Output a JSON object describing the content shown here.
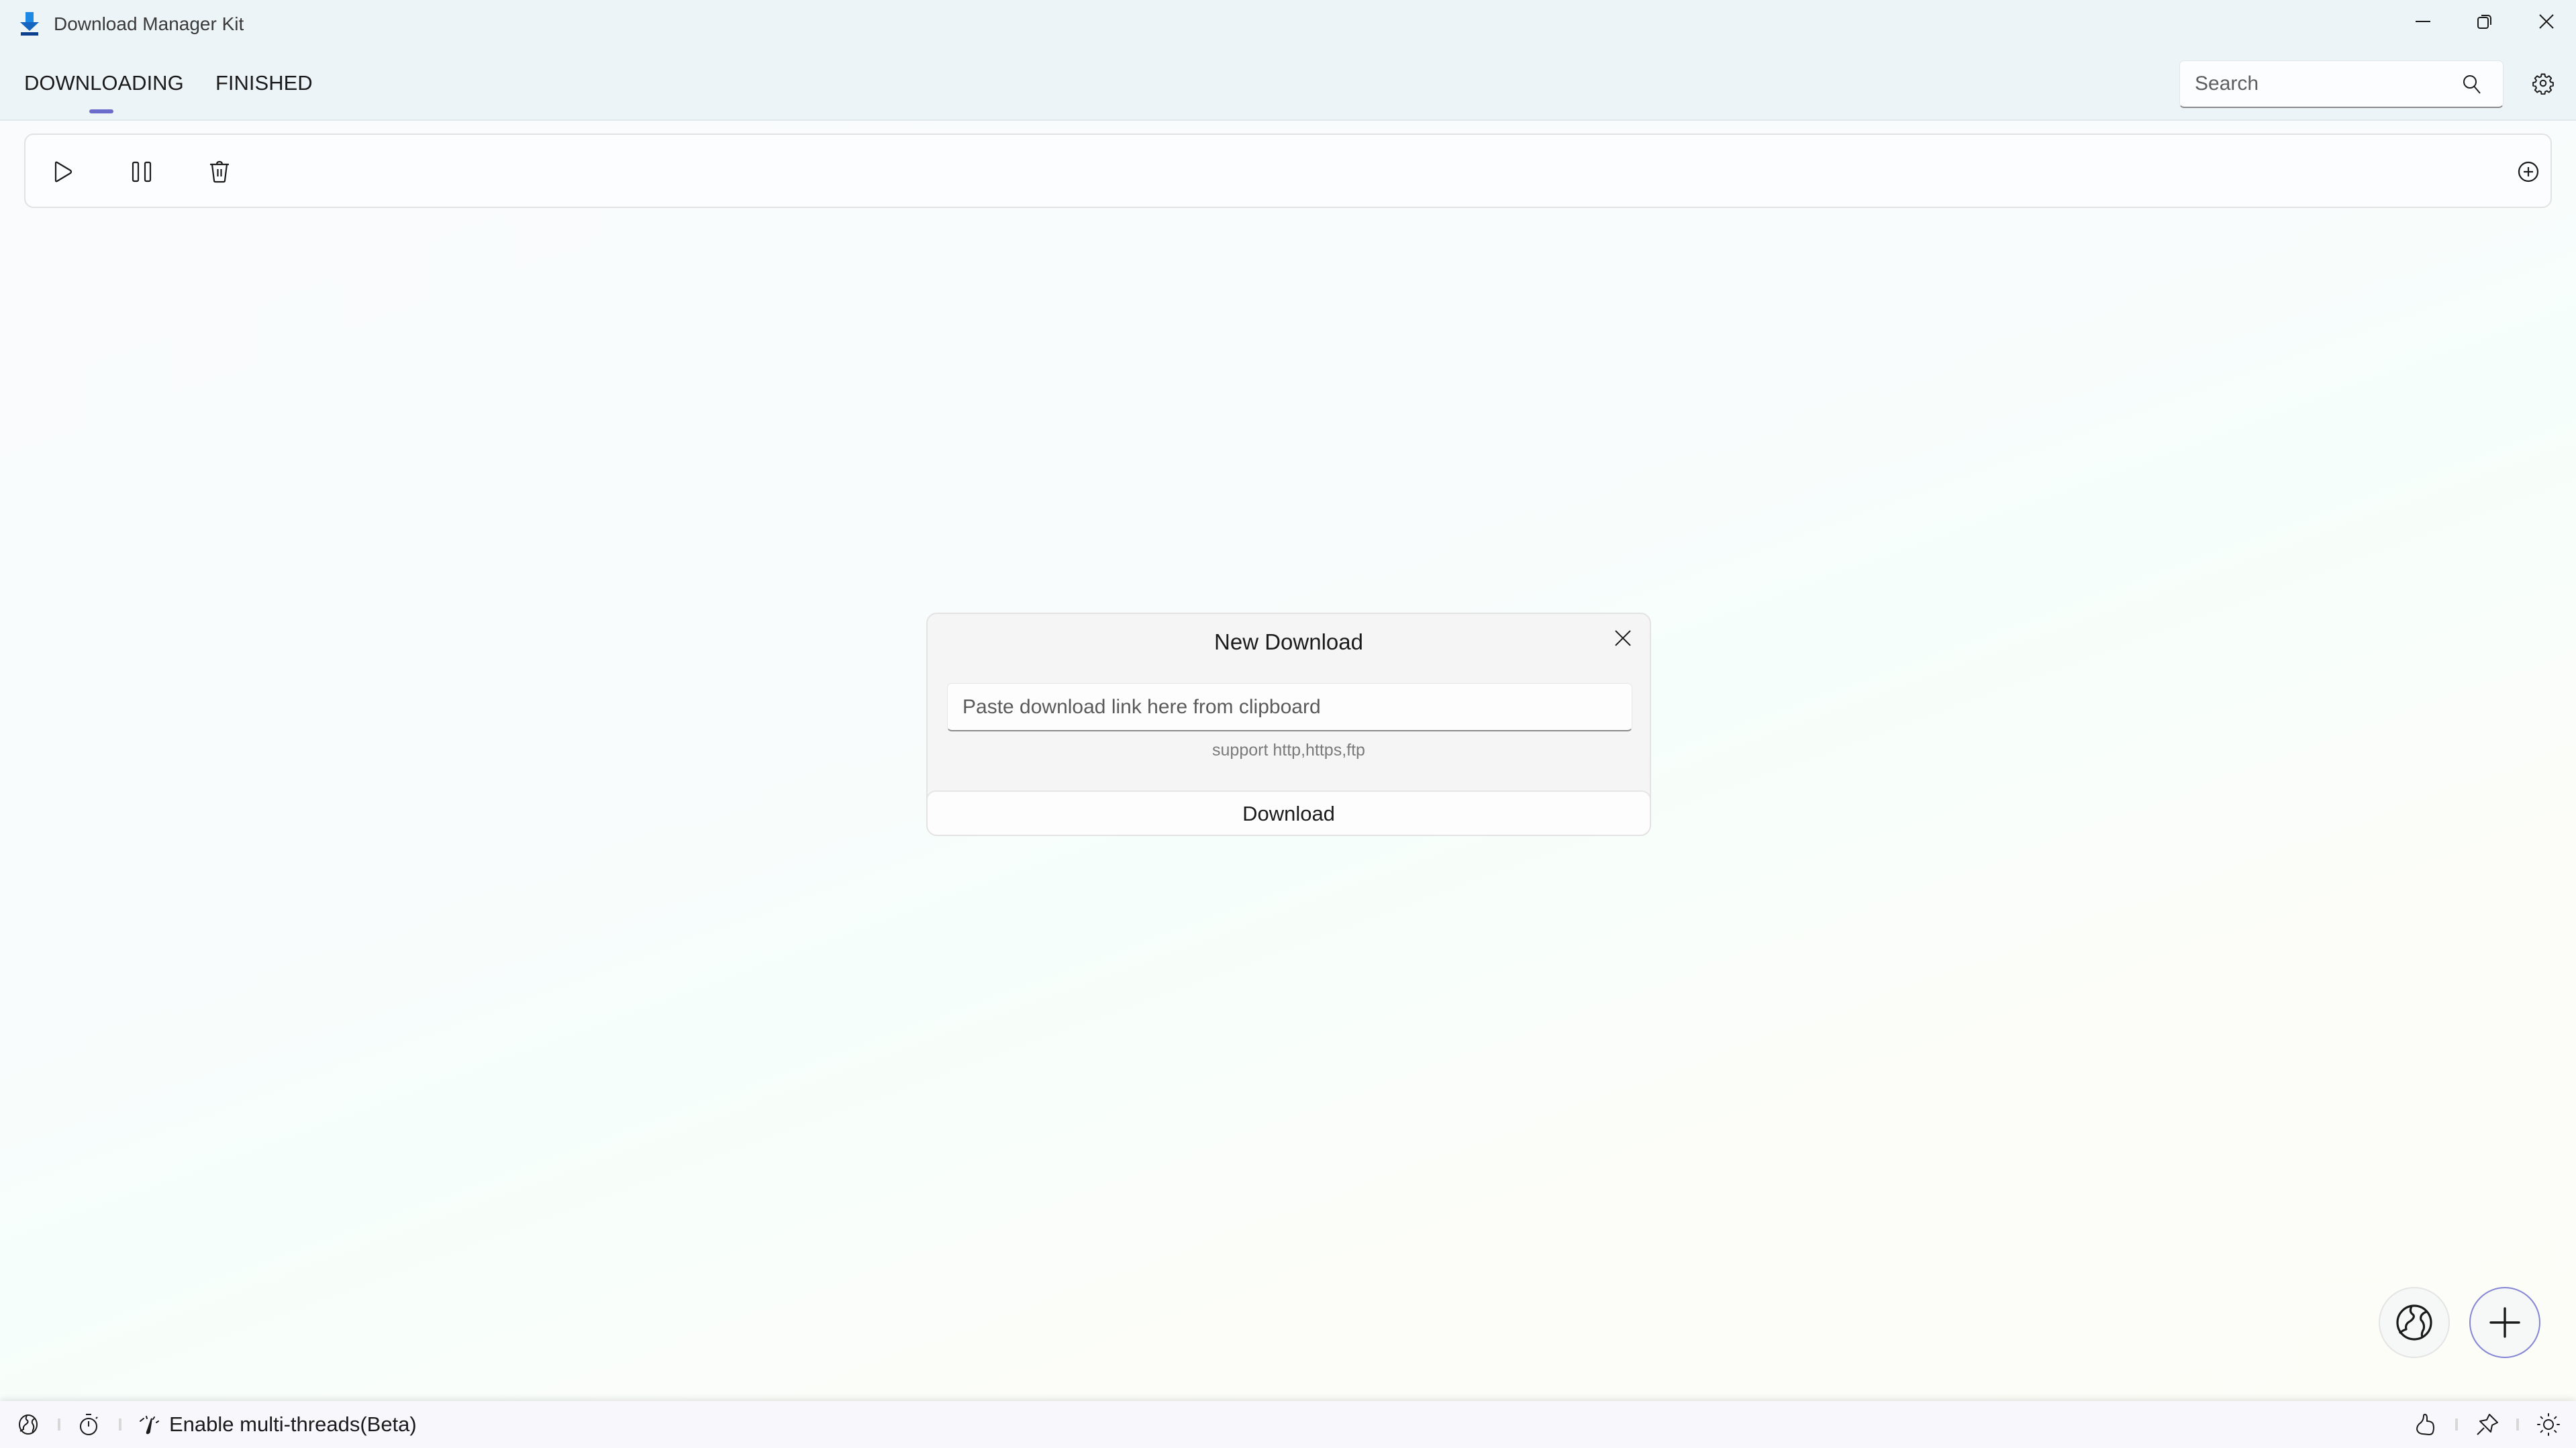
{
  "window": {
    "title": "Download Manager Kit",
    "app_icon": "download-arrow-icon",
    "controls": {
      "minimize": "minimize-icon",
      "restore": "restore-icon",
      "close": "close-icon"
    }
  },
  "header": {
    "tabs": [
      {
        "label": "DOWNLOADING",
        "active": true
      },
      {
        "label": "FINISHED",
        "active": false
      }
    ],
    "search": {
      "value": "",
      "placeholder": "Search",
      "icon": "search-icon"
    },
    "settings_icon": "gear-icon"
  },
  "toolbar": {
    "buttons": [
      {
        "name": "start",
        "icon": "play-icon"
      },
      {
        "name": "pause",
        "icon": "pause-icon"
      },
      {
        "name": "delete",
        "icon": "trash-icon"
      }
    ],
    "add_icon": "plus-circle-icon"
  },
  "dialog": {
    "title": "New Download",
    "url_input": {
      "value": "",
      "placeholder": "Paste download link here from clipboard"
    },
    "hint": "support http,https,ftp",
    "download_label": "Download"
  },
  "fabs": [
    {
      "name": "browser",
      "icon": "globe-icon"
    },
    {
      "name": "add",
      "icon": "plus-icon"
    }
  ],
  "statusbar": {
    "left_icons": [
      "globe-icon",
      "timer-icon",
      "speedometer-icon"
    ],
    "multithread_label": "Enable multi-threads(Beta)",
    "right_icons": [
      "thumbs-up-icon",
      "pin-icon",
      "sun-icon"
    ]
  },
  "colors": {
    "accent": "#6b6bcc",
    "header_bg": "#edf4f7",
    "dialog_bg": "#f5f5f5",
    "statusbar_bg": "#f8f8fc"
  }
}
